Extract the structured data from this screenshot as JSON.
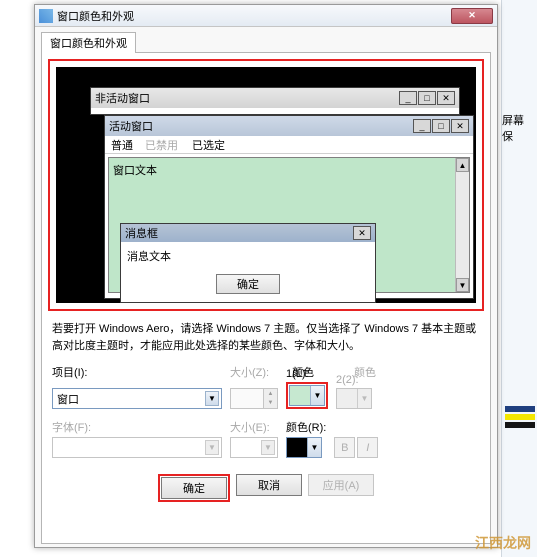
{
  "dialog": {
    "title": "窗口颜色和外观",
    "close_glyph": "✕",
    "tab_label": "窗口颜色和外观"
  },
  "preview": {
    "inactive_title": "非活动窗口",
    "active_title": "活动窗口",
    "menu_normal": "普通",
    "menu_disabled": "已禁用",
    "menu_selected": "已选定",
    "window_text": "窗口文本",
    "msgbox_title": "消息框",
    "msgbox_text": "消息文本",
    "msgbox_ok": "确定",
    "win_min": "_",
    "win_max": "□",
    "win_close": "✕"
  },
  "description": "若要打开 Windows Aero，请选择 Windows 7 主题。仅当选择了 Windows 7 基本主题或高对比度主题时，才能应用此处选择的某些颜色、字体和大小。",
  "controls": {
    "item_label": "项目(I):",
    "item_value": "窗口",
    "size_label": "大小(Z):",
    "color1_label_hdr": "颜色",
    "color1_label": "1(L):",
    "color2_label_hdr": "颜色",
    "color2_label": "2(2):",
    "font_label": "字体(F):",
    "fsize_label": "大小(E):",
    "fcolor_label": "颜色(R):",
    "bold": "B",
    "italic": "I"
  },
  "actions": {
    "ok": "确定",
    "cancel": "取消",
    "apply": "应用(A)"
  },
  "right": {
    "text": "屏幕保"
  },
  "watermark": "江西龙网"
}
